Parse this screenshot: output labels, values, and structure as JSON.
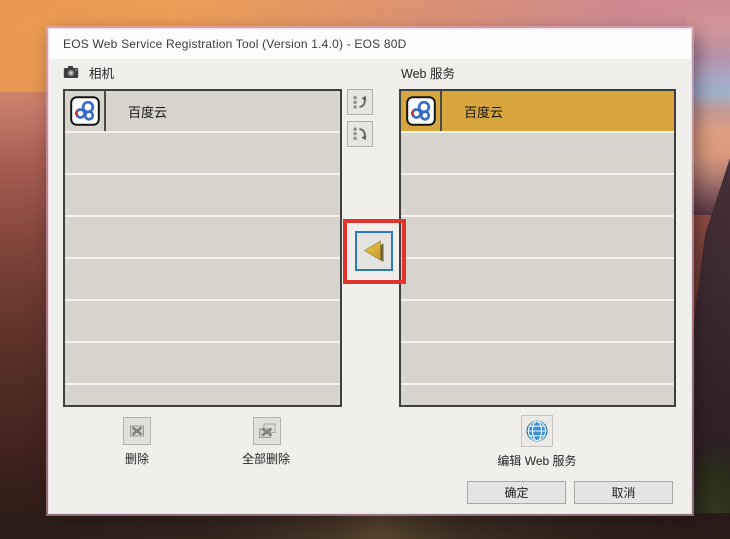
{
  "window": {
    "title": "EOS Web Service Registration Tool (Version 1.4.0) - EOS 80D"
  },
  "camera_panel": {
    "label": "相机",
    "icon": "camera-icon",
    "items": [
      {
        "name": "百度云",
        "icon": "baidu-cloud-icon",
        "selected": false
      }
    ],
    "empty_row_count": 7
  },
  "web_panel": {
    "label": "Web 服务",
    "items": [
      {
        "name": "百度云",
        "icon": "baidu-cloud-icon",
        "selected": true
      }
    ],
    "empty_row_count": 7
  },
  "middle_controls": {
    "move_up_icon": "list-move-up-icon",
    "move_down_icon": "list-move-down-icon",
    "assign_icon": "gold-left-arrow-icon"
  },
  "actions": {
    "delete": "删除",
    "delete_all": "全部删除",
    "edit_web_service": "编辑 Web 服务",
    "ok": "确定",
    "cancel": "取消"
  },
  "annotation": {
    "type": "red-highlight-box",
    "target": "assign-to-camera-button",
    "color": "#e0342a"
  },
  "colors": {
    "selected_row": "#d7a63d",
    "list_row": "#d7d4cd",
    "focus_border_blue": "#2b78be",
    "arrow_gold": "#e5b33c",
    "globe_blue": "#3b8fd0",
    "dialog_body": "#f0efec",
    "titlebar": "#fdfdfd"
  }
}
